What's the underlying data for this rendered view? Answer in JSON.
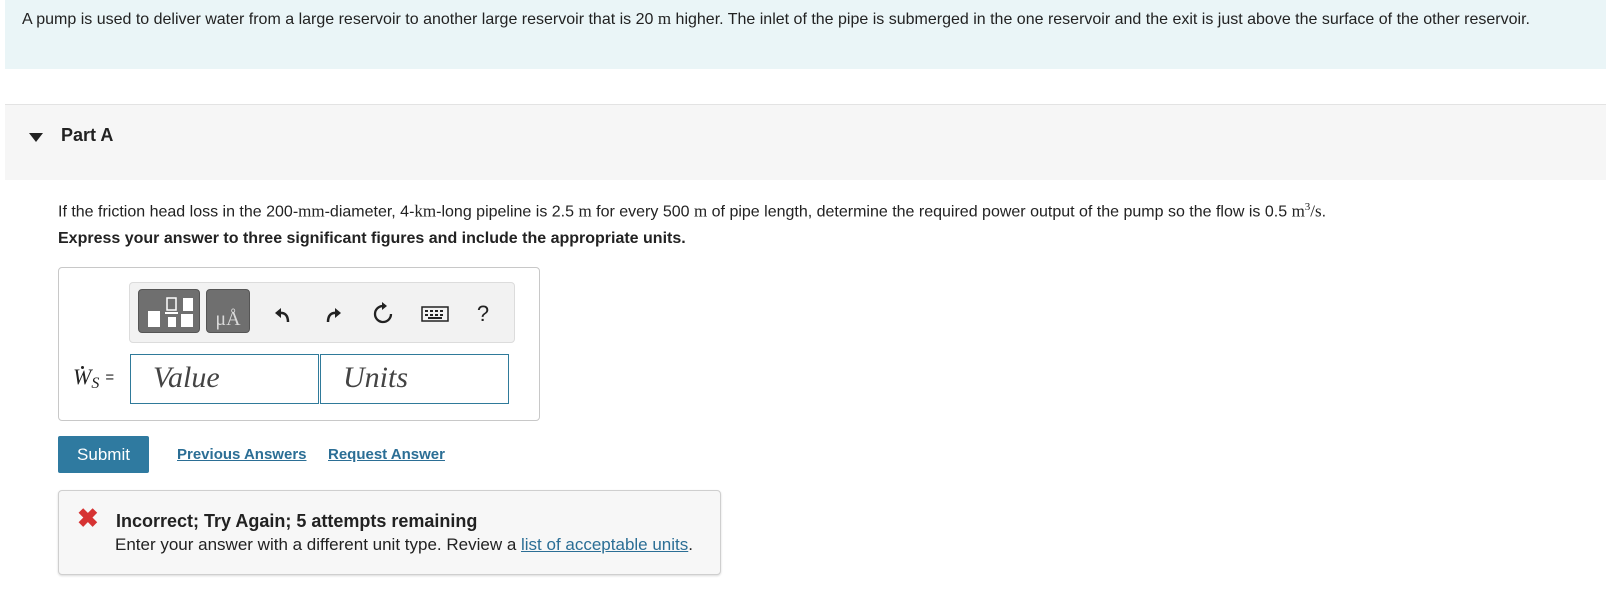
{
  "problem": {
    "text_1": "A pump is used to deliver water from a large reservoir to another large reservoir that is 20 ",
    "unit_1": "m",
    "text_2": " higher. The inlet of the pipe is submerged in the one reservoir and the exit is just above the surface of the other reservoir."
  },
  "part": {
    "title": "Part A",
    "question": {
      "t1": "If the friction head loss in the 200-",
      "u1": "mm",
      "t2": "-diameter, 4-",
      "u2": "km",
      "t3": "-long pipeline is 2.5 ",
      "u3": "m",
      "t4": " for every 500 ",
      "u4": "m",
      "t5": " of pipe length, determine the required power output of the pump so the flow is 0.5 ",
      "u5": "m",
      "sup": "3",
      "t6": "/s",
      "t7": "."
    },
    "instruction": "Express your answer to three significant figures and include the appropriate units."
  },
  "answer": {
    "toolbar": {
      "units_button_text": "μÅ",
      "help": "?"
    },
    "label_var": "W",
    "label_sub": "S",
    "label_eq": "=",
    "value_placeholder": "Value",
    "units_placeholder": "Units"
  },
  "actions": {
    "submit": "Submit",
    "previous_answers": "Previous Answers",
    "request_answer": "Request Answer"
  },
  "feedback": {
    "title": "Incorrect; Try Again; 5 attempts remaining",
    "message_pre": "Enter your answer with a different unit type. Review a ",
    "message_link": "list of acceptable units",
    "message_post": "."
  },
  "colors": {
    "accent": "#2f7aa0",
    "error": "#d63333",
    "problem_bg": "#eaf5f7"
  }
}
